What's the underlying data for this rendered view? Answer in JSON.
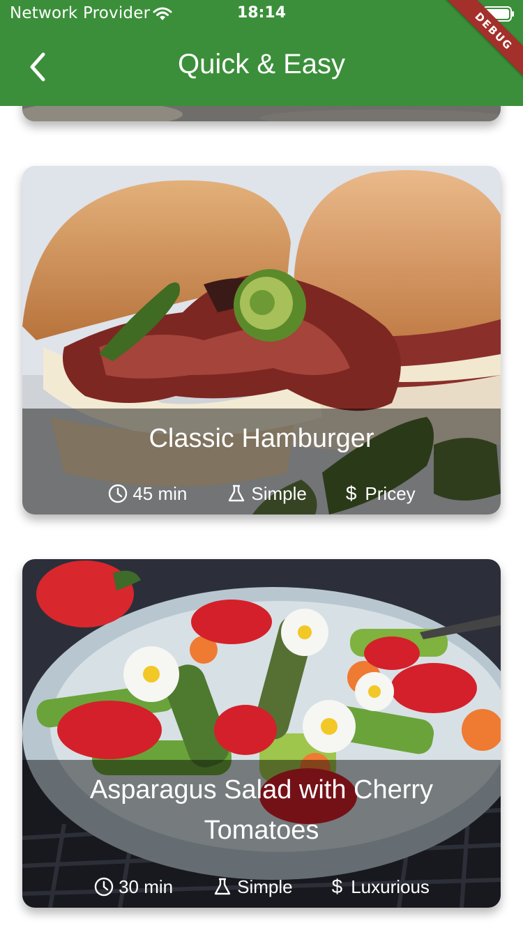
{
  "status_bar": {
    "carrier": "Network Provider",
    "time": "18:14"
  },
  "debug_banner": "DEBUG",
  "app_bar": {
    "title": "Quick & Easy"
  },
  "meals": [
    {
      "title": "Classic Hamburger",
      "duration": "45 min",
      "complexity": "Simple",
      "affordability": "Pricey",
      "image_icon": "hamburger-image"
    },
    {
      "title": "Asparagus Salad with Cherry Tomatoes",
      "duration": "30 min",
      "complexity": "Simple",
      "affordability": "Luxurious",
      "image_icon": "salad-image"
    }
  ],
  "colors": {
    "app_bar": "#3b8f3a",
    "debug_ribbon": "#a3302a",
    "overlay": "rgba(0,0,0,0.45)"
  }
}
